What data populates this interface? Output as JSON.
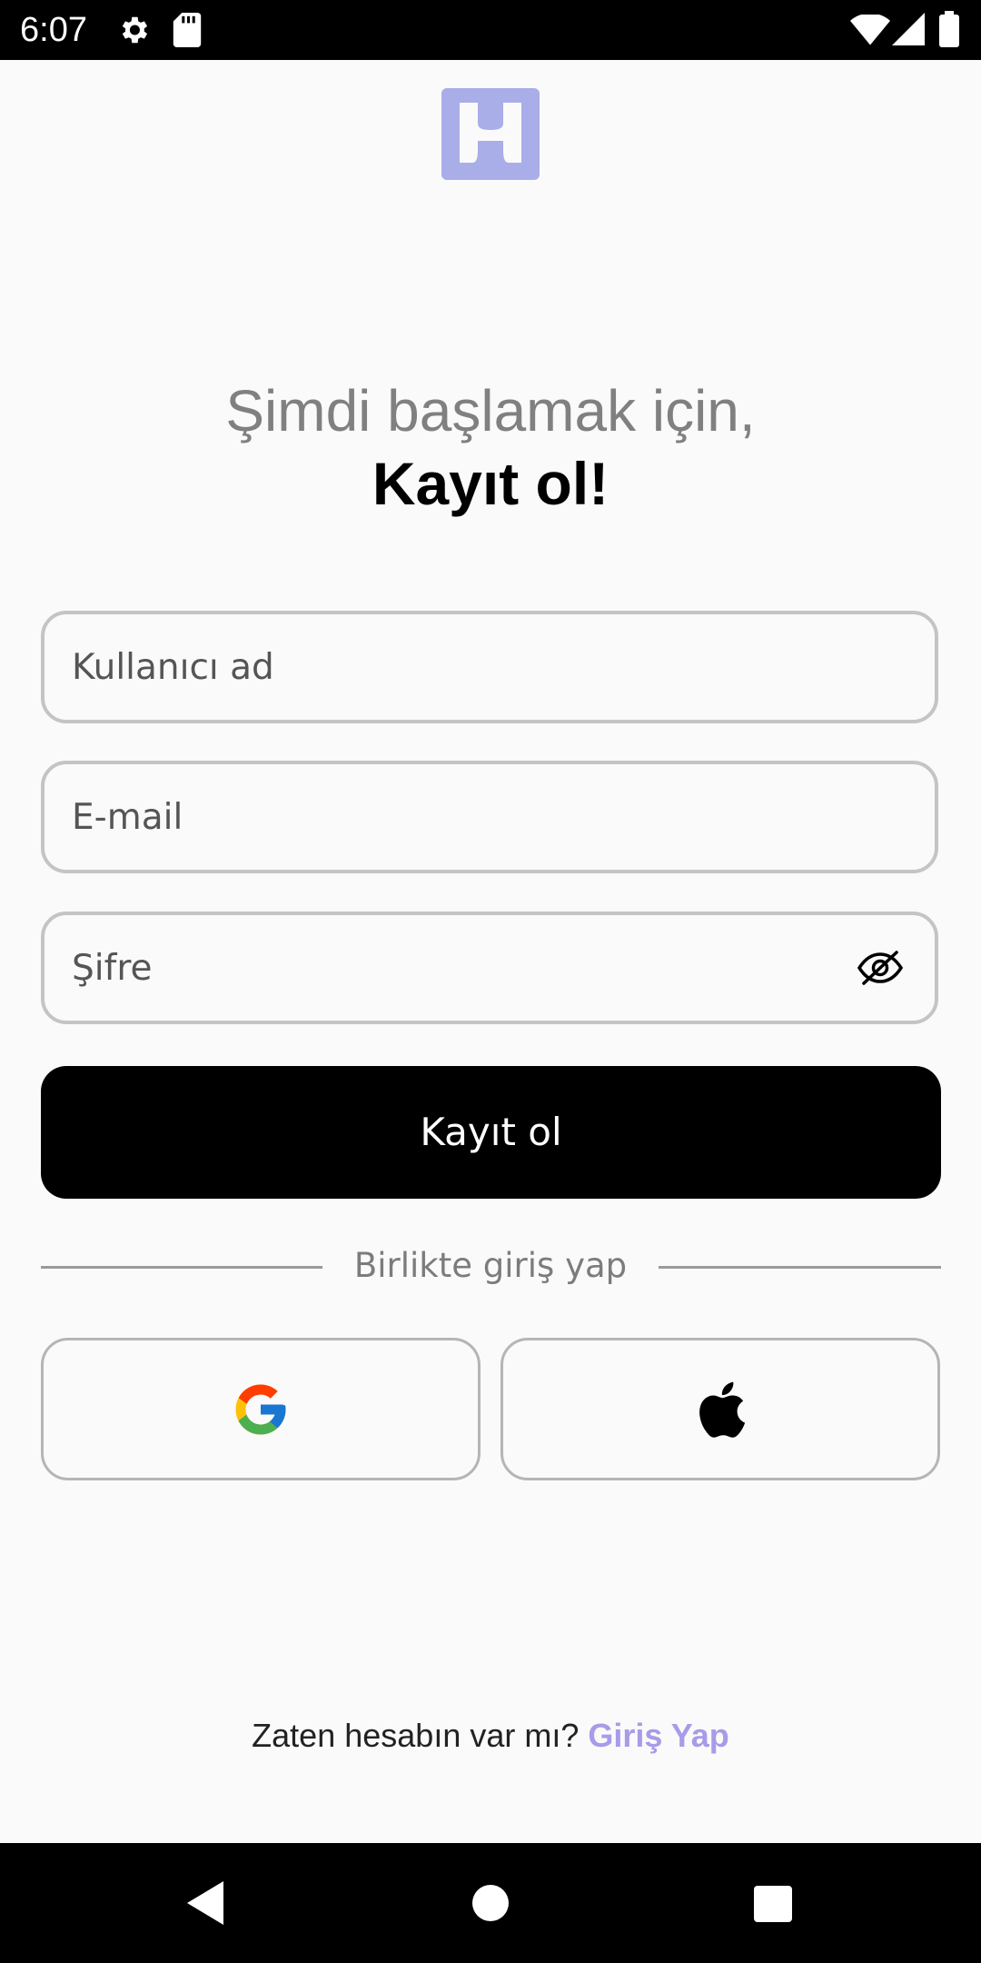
{
  "status_bar": {
    "time": "6:07",
    "icons": [
      "gear-icon",
      "sd-card-icon",
      "wifi-icon",
      "signal-icon",
      "battery-icon"
    ]
  },
  "header": {
    "logo_icon": "app-logo",
    "logo_color": "#a9aee8"
  },
  "headline": {
    "line1": "Şimdi başlamak için,",
    "line2": "Kayıt ol!"
  },
  "form": {
    "username_placeholder": "Kullanıcı ad",
    "email_placeholder": "E-mail",
    "password_placeholder": "Şifre",
    "password_toggle_icon": "eye-off-icon",
    "submit_label": "Kayıt ol"
  },
  "divider": {
    "label": "Birlikte giriş yap"
  },
  "social": {
    "google_icon": "google-icon",
    "apple_icon": "apple-icon"
  },
  "footer": {
    "prompt": "Zaten hesabın var mı? ",
    "link": "Giriş Yap",
    "link_color": "#a89be8"
  },
  "nav_bar": {
    "icons": [
      "back-icon",
      "home-icon",
      "recents-icon"
    ]
  }
}
